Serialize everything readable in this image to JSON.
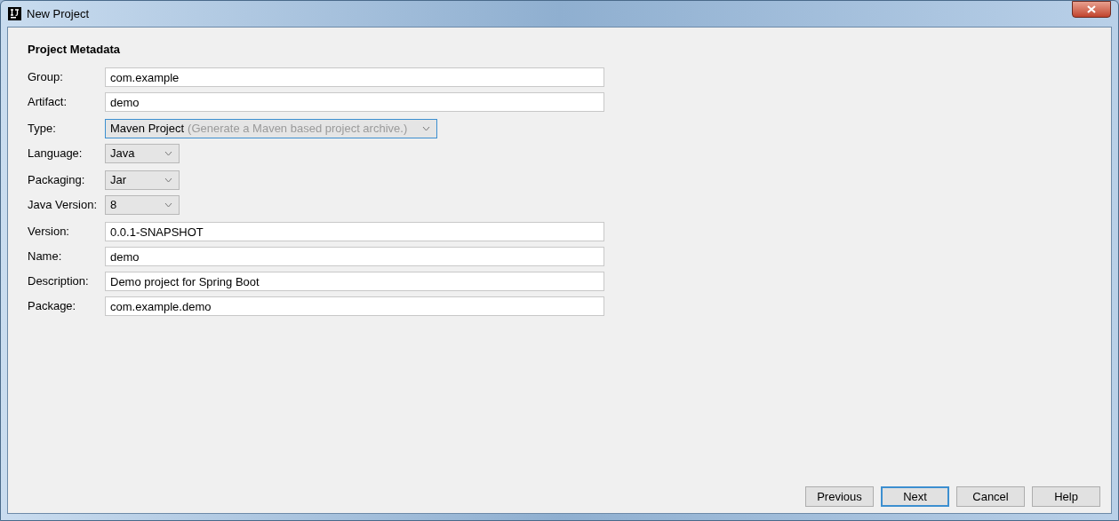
{
  "window": {
    "title": "New Project"
  },
  "heading": "Project Metadata",
  "groups": [
    {
      "fields": [
        {
          "label": "Group:",
          "kind": "text",
          "value": "com.example"
        },
        {
          "label": "Artifact:",
          "kind": "text",
          "value": "demo"
        }
      ]
    },
    {
      "fields": [
        {
          "label": "Type:",
          "kind": "dropdown",
          "value": "Maven Project",
          "detail": "(Generate a Maven based project archive.)",
          "focused": true
        },
        {
          "label": "Language:",
          "kind": "dropdown",
          "value": "Java",
          "focused": false
        }
      ]
    },
    {
      "fields": [
        {
          "label": "Packaging:",
          "kind": "dropdown",
          "value": "Jar",
          "focused": false
        },
        {
          "label": "Java Version:",
          "kind": "dropdown",
          "value": "8",
          "focused": false
        }
      ]
    },
    {
      "fields": [
        {
          "label": "Version:",
          "kind": "text",
          "value": "0.0.1-SNAPSHOT"
        },
        {
          "label": "Name:",
          "kind": "text",
          "value": "demo"
        },
        {
          "label": "Description:",
          "kind": "text",
          "value": "Demo project for Spring Boot"
        },
        {
          "label": "Package:",
          "kind": "text",
          "value": "com.example.demo"
        }
      ]
    }
  ],
  "buttons": [
    {
      "label": "Previous",
      "focused": false
    },
    {
      "label": "Next",
      "focused": true
    },
    {
      "label": "Cancel",
      "focused": false
    },
    {
      "label": "Help",
      "focused": false
    }
  ]
}
